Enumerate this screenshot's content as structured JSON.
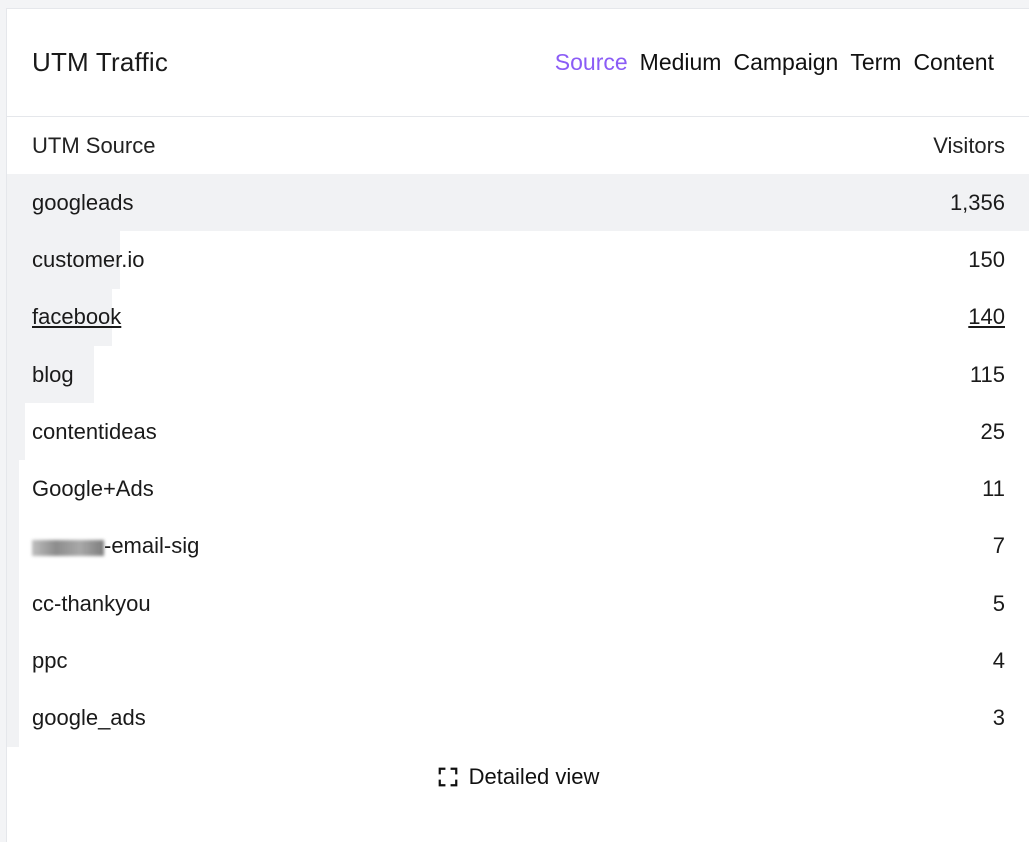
{
  "header": {
    "title": "UTM Traffic",
    "tabs": [
      {
        "label": "Source",
        "active": true
      },
      {
        "label": "Medium",
        "active": false
      },
      {
        "label": "Campaign",
        "active": false
      },
      {
        "label": "Term",
        "active": false
      },
      {
        "label": "Content",
        "active": false
      }
    ]
  },
  "table": {
    "col_label": "UTM Source",
    "col_value": "Visitors",
    "rows": [
      {
        "label": "googleads",
        "value": "1,356",
        "share": 1.0
      },
      {
        "label": "customer.io",
        "value": "150",
        "share": 0.111
      },
      {
        "label": "facebook",
        "value": "140",
        "share": 0.103
      },
      {
        "label": "blog",
        "value": "115",
        "share": 0.085
      },
      {
        "label": "contentideas",
        "value": "25",
        "share": 0.018
      },
      {
        "label": "Google+Ads",
        "value": "11",
        "share": 0.008
      },
      {
        "label": "-email-sig",
        "value": "7",
        "share": 0.005
      },
      {
        "label": "cc-thankyou",
        "value": "5",
        "share": 0.004
      },
      {
        "label": "ppc",
        "value": "4",
        "share": 0.003
      },
      {
        "label": "google_ads",
        "value": "3",
        "share": 0.002
      }
    ]
  },
  "footer": {
    "detail_label": "Detailed view",
    "detail_icon": "expand-icon"
  },
  "colors": {
    "accent": "#8b5cf6",
    "bar": "#f1f2f4"
  }
}
